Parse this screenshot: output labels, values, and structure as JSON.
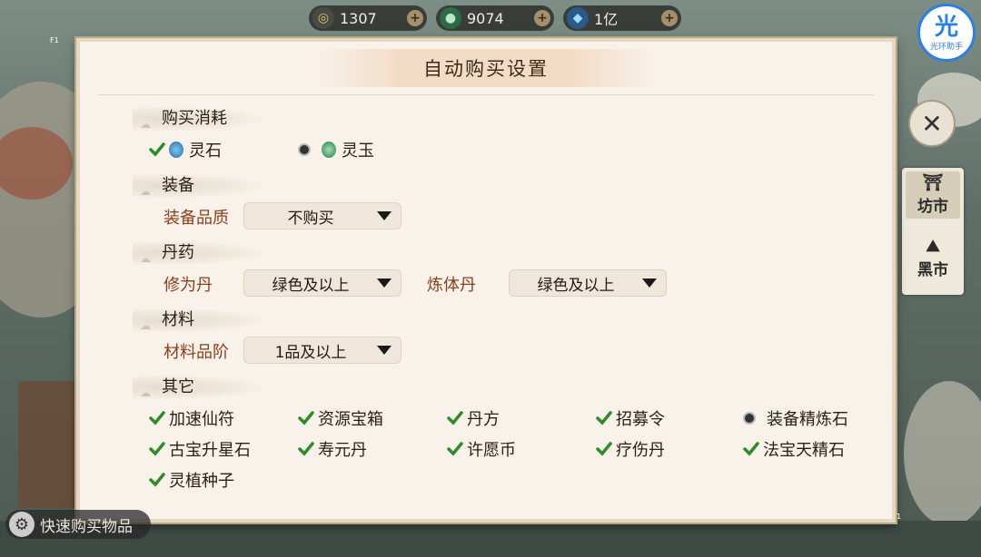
{
  "currencies": [
    {
      "icon": "spirit-stone-coin-icon",
      "value": "1307"
    },
    {
      "icon": "spirit-jade-coin-icon",
      "value": "9074"
    },
    {
      "icon": "blue-gem-icon",
      "value": "1亿"
    }
  ],
  "helper_badge": {
    "char": "光",
    "label": "光环助手"
  },
  "hotkey_label": "F1",
  "panel": {
    "title": "自动购买设置"
  },
  "sections": {
    "consume": {
      "title": "购买消耗",
      "options": [
        {
          "label": "灵石",
          "checked": true,
          "icon": "spirit-stone-icon"
        },
        {
          "label": "灵玉",
          "checked": false,
          "icon": "spirit-jade-icon"
        }
      ]
    },
    "equipment": {
      "title": "装备",
      "quality_label": "装备品质",
      "quality_value": "不购买"
    },
    "pills": {
      "title": "丹药",
      "cultivation_label": "修为丹",
      "cultivation_value": "绿色及以上",
      "body_label": "炼体丹",
      "body_value": "绿色及以上"
    },
    "materials": {
      "title": "材料",
      "grade_label": "材料品阶",
      "grade_value": "1品及以上"
    },
    "others": {
      "title": "其它",
      "items": [
        {
          "label": "加速仙符",
          "checked": true
        },
        {
          "label": "资源宝箱",
          "checked": true
        },
        {
          "label": "丹方",
          "checked": true
        },
        {
          "label": "招募令",
          "checked": true
        },
        {
          "label": "装备精炼石",
          "checked": false
        },
        {
          "label": "古宝升星石",
          "checked": true
        },
        {
          "label": "寿元丹",
          "checked": true
        },
        {
          "label": "许愿币",
          "checked": true
        },
        {
          "label": "疗伤丹",
          "checked": true
        },
        {
          "label": "法宝天精石",
          "checked": true
        },
        {
          "label": "灵植种子",
          "checked": true
        }
      ]
    }
  },
  "side_tabs": [
    {
      "label": "坊市",
      "icon": "market-stall-icon",
      "active": true
    },
    {
      "label": "黑市",
      "icon": "black-market-icon",
      "active": false
    }
  ],
  "quick_button_label": "快速购买物品",
  "corner_mark": "1",
  "colors": {
    "accent_brown": "#8a3e1a",
    "check_green": "#2f8a2a",
    "panel_bg": "#f8f2ea"
  }
}
